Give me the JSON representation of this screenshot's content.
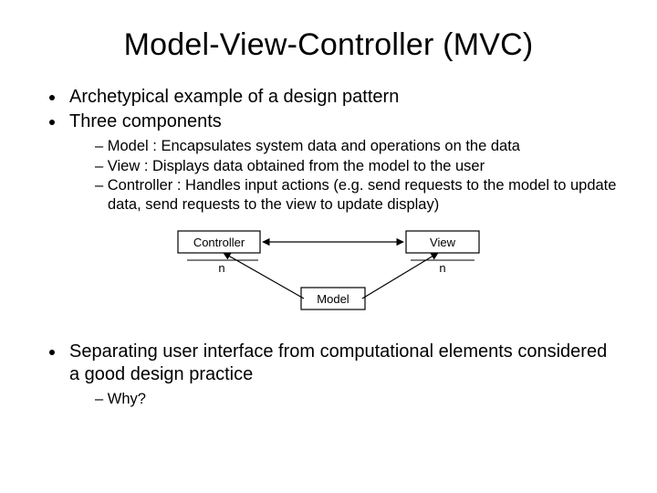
{
  "title": "Model-View-Controller (MVC)",
  "bullets": {
    "b1": "Archetypical example of a design pattern",
    "b2": "Three components",
    "b2_sub": {
      "s1": "Model : Encapsulates system data and operations on the data",
      "s2": "View : Displays data obtained from the model to the user",
      "s3": "Controller : Handles input actions (e.g. send requests to the model to update data, send requests to the view to update display)"
    },
    "b3": "Separating user interface from computational elements considered a good design practice",
    "b3_sub": {
      "s1": "Why?"
    }
  },
  "diagram": {
    "controller": "Controller",
    "view": "View",
    "model": "Model",
    "mult_controller": "n",
    "mult_view": "n"
  }
}
